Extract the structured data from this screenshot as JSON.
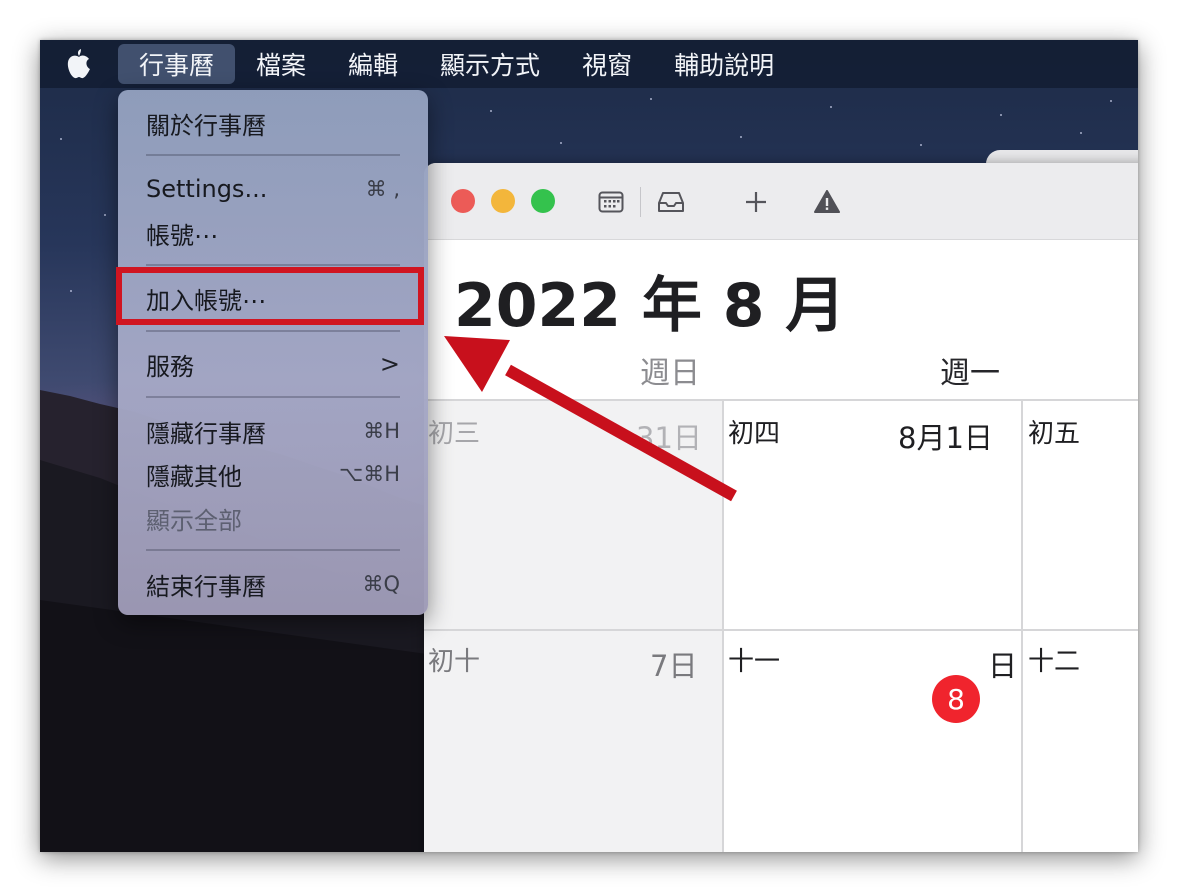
{
  "menubar": {
    "apple_icon": "apple-logo-icon",
    "items": [
      "行事曆",
      "檔案",
      "編輯",
      "顯示方式",
      "視窗",
      "輔助說明"
    ]
  },
  "app_menu": {
    "about": "關於行事曆",
    "settings": {
      "label": "Settings...",
      "shortcut": "⌘ ,"
    },
    "accounts": "帳號⋯",
    "add_account": "加入帳號⋯",
    "services": {
      "label": "服務",
      "chevron": ">"
    },
    "hide_app": {
      "label": "隱藏行事曆",
      "shortcut": "⌘H"
    },
    "hide_others": {
      "label": "隱藏其他",
      "shortcut": "⌥⌘H"
    },
    "show_all": "顯示全部",
    "quit": {
      "label": "結束行事曆",
      "shortcut": "⌘Q"
    }
  },
  "calendar": {
    "toolbar_icons": [
      "calendar-list-icon",
      "inbox-icon",
      "add-event-icon",
      "alert-icon"
    ],
    "month_title": "2022 年 8 月",
    "weekdays": [
      "週日",
      "週一"
    ],
    "week1": [
      {
        "lunar": "初三",
        "day": "31日"
      },
      {
        "lunar": "初四",
        "day": "8月1日"
      },
      {
        "lunar": "初五",
        "day": ""
      }
    ],
    "week2": [
      {
        "lunar": "初十",
        "day": "7日"
      },
      {
        "lunar": "十一",
        "day_number": "8",
        "day_suffix": "日"
      },
      {
        "lunar": "十二",
        "day": ""
      }
    ]
  },
  "colors": {
    "highlight": "#d01521",
    "arrow": "#c8101c",
    "today": "#f0242d",
    "close": "#ec5b57",
    "minimize": "#f3b63b",
    "zoom": "#34c24d"
  }
}
